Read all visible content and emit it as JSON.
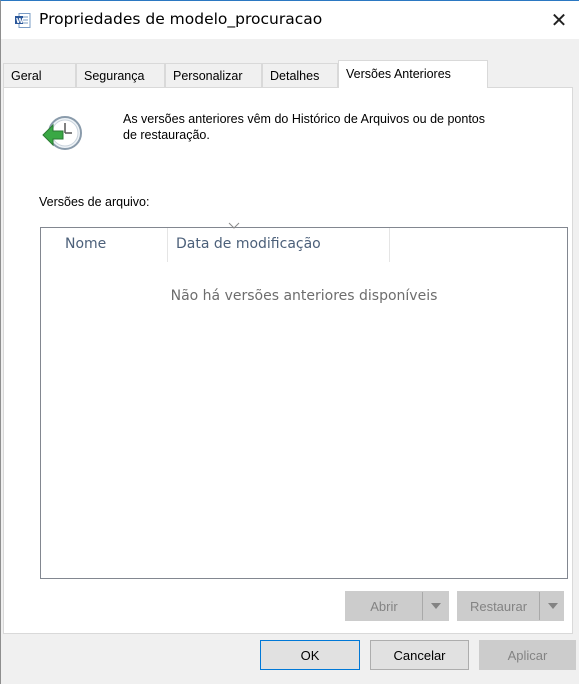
{
  "window": {
    "title": "Propriedades de modelo_procuracao",
    "close_symbol": "✕"
  },
  "tabs": [
    {
      "label": "Geral",
      "active": false
    },
    {
      "label": "Segurança",
      "active": false
    },
    {
      "label": "Personalizar",
      "active": false
    },
    {
      "label": "Detalhes",
      "active": false
    },
    {
      "label": "Versões Anteriores",
      "active": true
    }
  ],
  "panel": {
    "info_line1": "As versões anteriores vêm do Histórico de Arquivos ou de pontos",
    "info_line2": "de restauração.",
    "versions_label": "Versões de arquivo:",
    "columns": [
      "Nome",
      "Data de modificação"
    ],
    "empty_message": "Não há versões anteriores disponíveis",
    "open_button": "Abrir",
    "restore_button": "Restaurar"
  },
  "footer": {
    "ok": "OK",
    "cancel": "Cancelar",
    "apply": "Aplicar"
  },
  "icons": {
    "title_icon": "word-document-icon",
    "history_icon": "clock-restore-icon",
    "dropdown": "chevron-down-icon"
  },
  "colors": {
    "accent": "#0078d7",
    "disabled_bg": "#cccccc",
    "disabled_text": "#838383",
    "header_text": "#4c607a"
  }
}
